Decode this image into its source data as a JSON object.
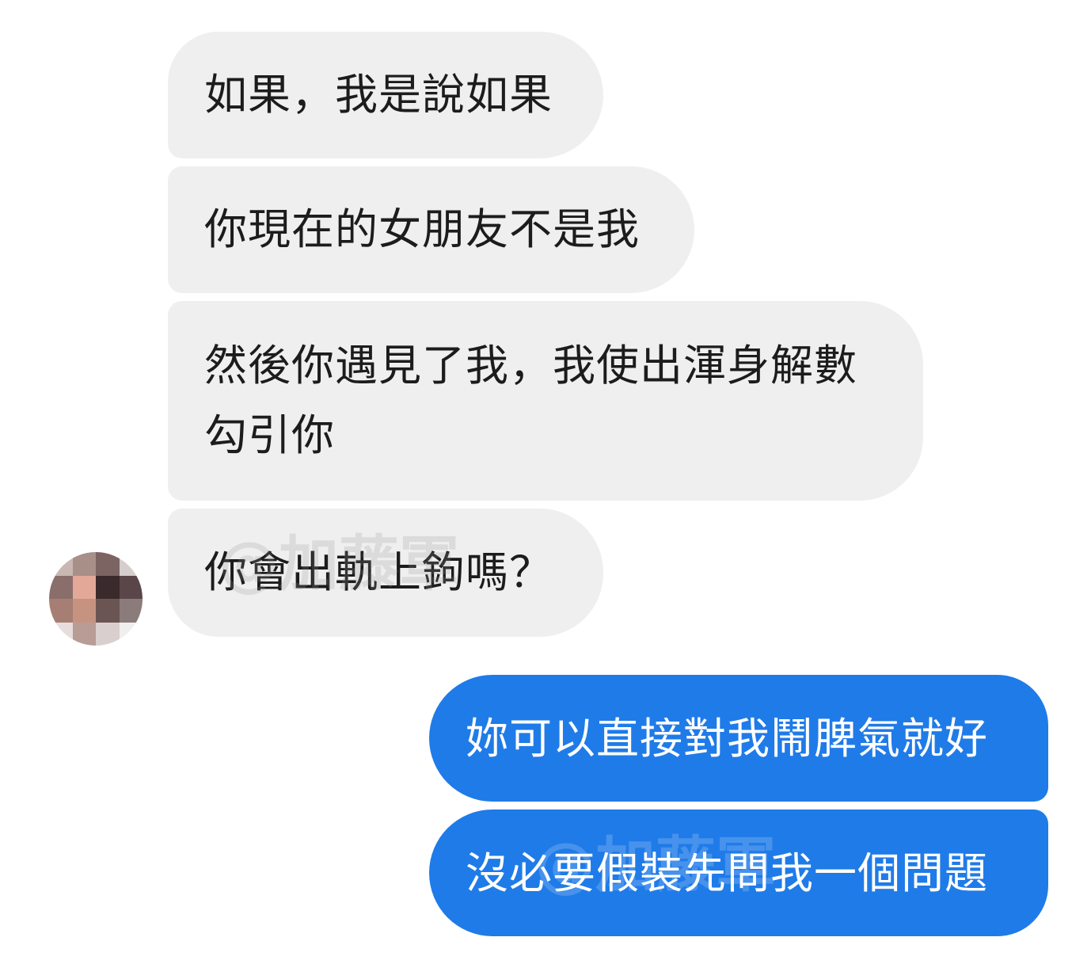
{
  "conversation": {
    "incoming": [
      {
        "lines": [
          "如果，我是說如果"
        ]
      },
      {
        "lines": [
          "你現在的女朋友不是我"
        ]
      },
      {
        "lines": [
          "然後你遇見了我，我使出渾身解數",
          "勾引你"
        ]
      },
      {
        "lines": [
          "你會出軌上鉤嗎？"
        ]
      }
    ],
    "outgoing": [
      {
        "lines": [
          "妳可以直接對我鬧脾氣就好"
        ]
      },
      {
        "lines": [
          "沒必要假裝先問我一個問題"
        ]
      }
    ]
  },
  "watermark": {
    "text": "@加藤軍"
  },
  "colors": {
    "incoming_bubble": "#efefef",
    "outgoing_bubble": "#1f7be8",
    "background": "#ffffff"
  },
  "avatar": {
    "icon": "pixelated-avatar-icon",
    "pixels": [
      "#c9b7b2",
      "#a88f88",
      "#7b6462",
      "#d6cdcd",
      "#8a6e6b",
      "#e3a898",
      "#3a2a2c",
      "#5a4648",
      "#a77e73",
      "#c69381",
      "#6b5552",
      "#8c7b7b",
      "#e6dddc",
      "#b99c95",
      "#d9cfcf",
      "#f1eeee"
    ]
  }
}
